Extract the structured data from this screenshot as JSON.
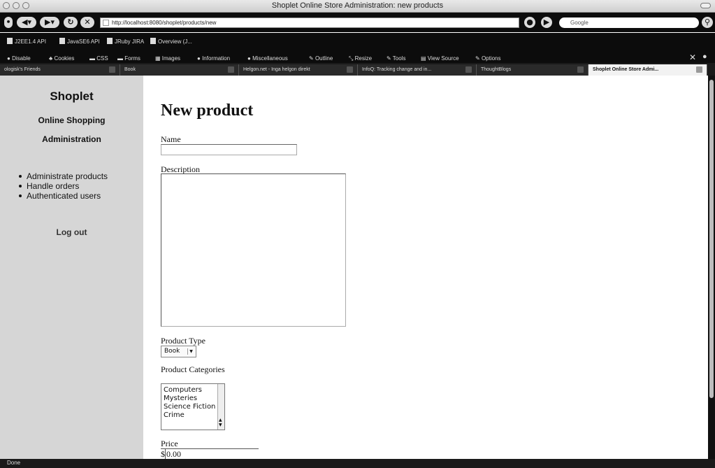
{
  "window": {
    "title": "Shoplet Online Store Administration: new products"
  },
  "toolbar": {
    "url": "http://localhost:8080/shoplet/products/new",
    "search_placeholder": "Google"
  },
  "bookmarks": [
    "J2EE1.4 API",
    "JavaSE6 API",
    "JRuby JIRA",
    "Overview (J..."
  ],
  "devtools": [
    "Disable",
    "Cookies",
    "CSS",
    "Forms",
    "Images",
    "Information",
    "Miscellaneous",
    "Outline",
    "Resize",
    "Tools",
    "View Source",
    "Options"
  ],
  "tabs": [
    {
      "label": "ologisk's Friends"
    },
    {
      "label": "Book"
    },
    {
      "label": "Helgon.net - Inga helgon direkt"
    },
    {
      "label": "InfoQ: Tracking change and in..."
    },
    {
      "label": "ThoughtBlogs"
    },
    {
      "label": "Shoplet Online Store Admi..."
    }
  ],
  "sidebar": {
    "brand": "Shoplet",
    "subtitle1": "Online Shopping",
    "subtitle2": "Administration",
    "items": [
      {
        "label": "Administrate products"
      },
      {
        "label": "Handle orders"
      },
      {
        "label": "Authenticated users"
      }
    ],
    "logout": "Log out"
  },
  "form": {
    "title": "New product",
    "name_label": "Name",
    "name_value": "",
    "description_label": "Description",
    "description_value": "",
    "type_label": "Product Type",
    "type_value": "Book",
    "categories_label": "Product Categories",
    "categories": [
      "Computers",
      "Mysteries",
      "Science Fiction",
      "Crime"
    ],
    "price_label": "Price",
    "price_currency": "$",
    "price_value": "0.00"
  },
  "status": {
    "text": "Done"
  }
}
